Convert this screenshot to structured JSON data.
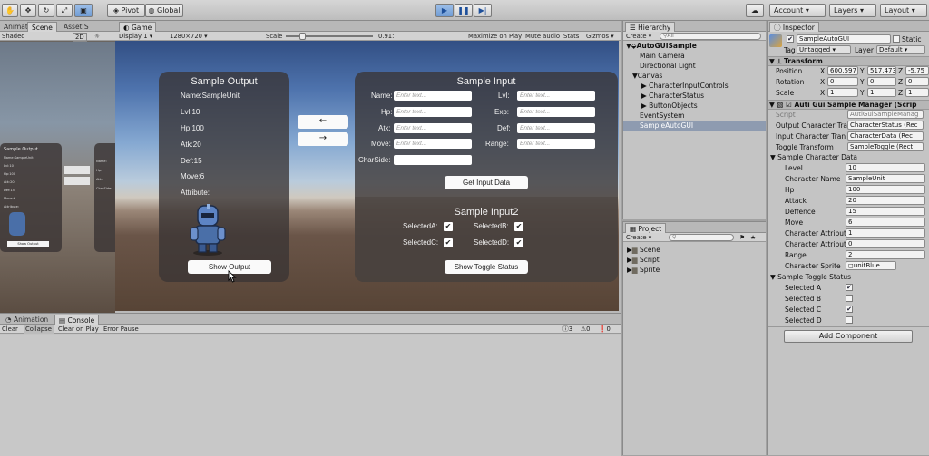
{
  "toolbar": {
    "pivot_label": "Pivot",
    "global_label": "Global",
    "account_label": "Account",
    "layers_label": "Layers",
    "layout_label": "Layout"
  },
  "left_panel": {
    "tabs": [
      "Animat",
      "Scene",
      "Asset S"
    ],
    "shading": "Shaded",
    "mode": "2D"
  },
  "game": {
    "tab_label": "Game",
    "display": "Display 1",
    "resolution": "1280×720",
    "scale_label": "Scale",
    "scale_value": "0.91:",
    "buttons": [
      "Maximize on Play",
      "Mute audio",
      "Stats",
      "Gizmos"
    ]
  },
  "sample_output": {
    "title": "Sample Output",
    "lines": [
      "Name:SampleUnit",
      "Lvl:10",
      "Hp:100",
      "Atk:20",
      "Def:15",
      "Move:6",
      "Attribute:"
    ],
    "button": "Show Output"
  },
  "arrows": {
    "left": "←",
    "right": "→"
  },
  "sample_input": {
    "title": "Sample Input",
    "left_labels": [
      "Name:",
      "Hp:",
      "Atk:",
      "Move:",
      "CharSide:"
    ],
    "right_labels": [
      "Lvl:",
      "Exp:",
      "Def:",
      "Range:"
    ],
    "placeholder": "Enter text...",
    "button": "Get Input Data"
  },
  "sample_input2": {
    "title": "Sample Input2",
    "checks": [
      {
        "label": "SelectedA:",
        "checked": true
      },
      {
        "label": "SelectedB:",
        "checked": true
      },
      {
        "label": "SelectedC:",
        "checked": true
      },
      {
        "label": "SelectedD:",
        "checked": true
      }
    ],
    "button": "Show Toggle Status"
  },
  "scene_mini": {
    "title": "Sample Output",
    "lines": [
      "Name:SampleUnit",
      "Lvl:10",
      "Hp:100",
      "Atk:20",
      "Def:15",
      "Move:6",
      "Attribute:"
    ],
    "button": "Show Output",
    "right_lines": [
      "Name:",
      "Hp:",
      "Atk:",
      "CharSide:"
    ]
  },
  "console": {
    "tabs": [
      "Animation",
      "Console"
    ],
    "buttons": [
      "Clear",
      "Collapse",
      "Clear on Play",
      "Error Pause"
    ],
    "counts": [
      "3",
      "0",
      "0"
    ]
  },
  "hierarchy": {
    "tab_label": "Hierarchy",
    "create": "Create",
    "search_placeholder": "All",
    "items": [
      {
        "label": "AutoGUISample"
      },
      {
        "label": "Main Camera"
      },
      {
        "label": "Directional Light"
      },
      {
        "label": "Canvas"
      },
      {
        "label": "CharacterInputControls"
      },
      {
        "label": "CharacterStatus"
      },
      {
        "label": "ButtonObjects"
      },
      {
        "label": "EventSystem"
      },
      {
        "label": "SampleAutoGUI"
      }
    ]
  },
  "project": {
    "tab_label": "Project",
    "create": "Create",
    "folders": [
      "Scene",
      "Script",
      "Sprite"
    ]
  },
  "inspector": {
    "tab_label": "Inspector",
    "object_name": "SampleAutoGUI",
    "static_label": "Static",
    "tag_label": "Tag",
    "tag_value": "Untagged",
    "layer_label": "Layer",
    "layer_value": "Default",
    "transform": {
      "title": "Transform",
      "position": {
        "label": "Position",
        "x": "600.597",
        "y": "517.473",
        "z": "-5.75"
      },
      "rotation": {
        "label": "Rotation",
        "x": "0",
        "y": "0",
        "z": "0"
      },
      "scale": {
        "label": "Scale",
        "x": "1",
        "y": "1",
        "z": "1"
      }
    },
    "component": {
      "title": "Auti Gui Sample Manager (Scrip",
      "script_label": "Script",
      "script_value": "AutiGuiSampleManag",
      "refs": [
        {
          "label": "Output Character Tra",
          "value": "CharacterStatus (Rec"
        },
        {
          "label": "Input Character Tran",
          "value": "CharacterData (Rec"
        },
        {
          "label": "Toggle Transform",
          "value": "SampleToggle (Rect"
        }
      ]
    },
    "character_data": {
      "title": "Sample Character Data",
      "fields": [
        {
          "label": "Level",
          "value": "10"
        },
        {
          "label": "Character Name",
          "value": "SampleUnit"
        },
        {
          "label": "Hp",
          "value": "100"
        },
        {
          "label": "Attack",
          "value": "20"
        },
        {
          "label": "Deffence",
          "value": "15"
        },
        {
          "label": "Move",
          "value": "6"
        },
        {
          "label": "Character Attribut",
          "value": "1"
        },
        {
          "label": "Character Attribut",
          "value": "0"
        },
        {
          "label": "Range",
          "value": "2"
        },
        {
          "label": "Character Sprite",
          "value": "unitBlue"
        }
      ]
    },
    "toggle_status": {
      "title": "Sample Toggle Status",
      "items": [
        {
          "label": "Selected A",
          "checked": true
        },
        {
          "label": "Selected B",
          "checked": false
        },
        {
          "label": "Selected C",
          "checked": true
        },
        {
          "label": "Selected D",
          "checked": false
        }
      ]
    },
    "add_component": "Add Component"
  }
}
